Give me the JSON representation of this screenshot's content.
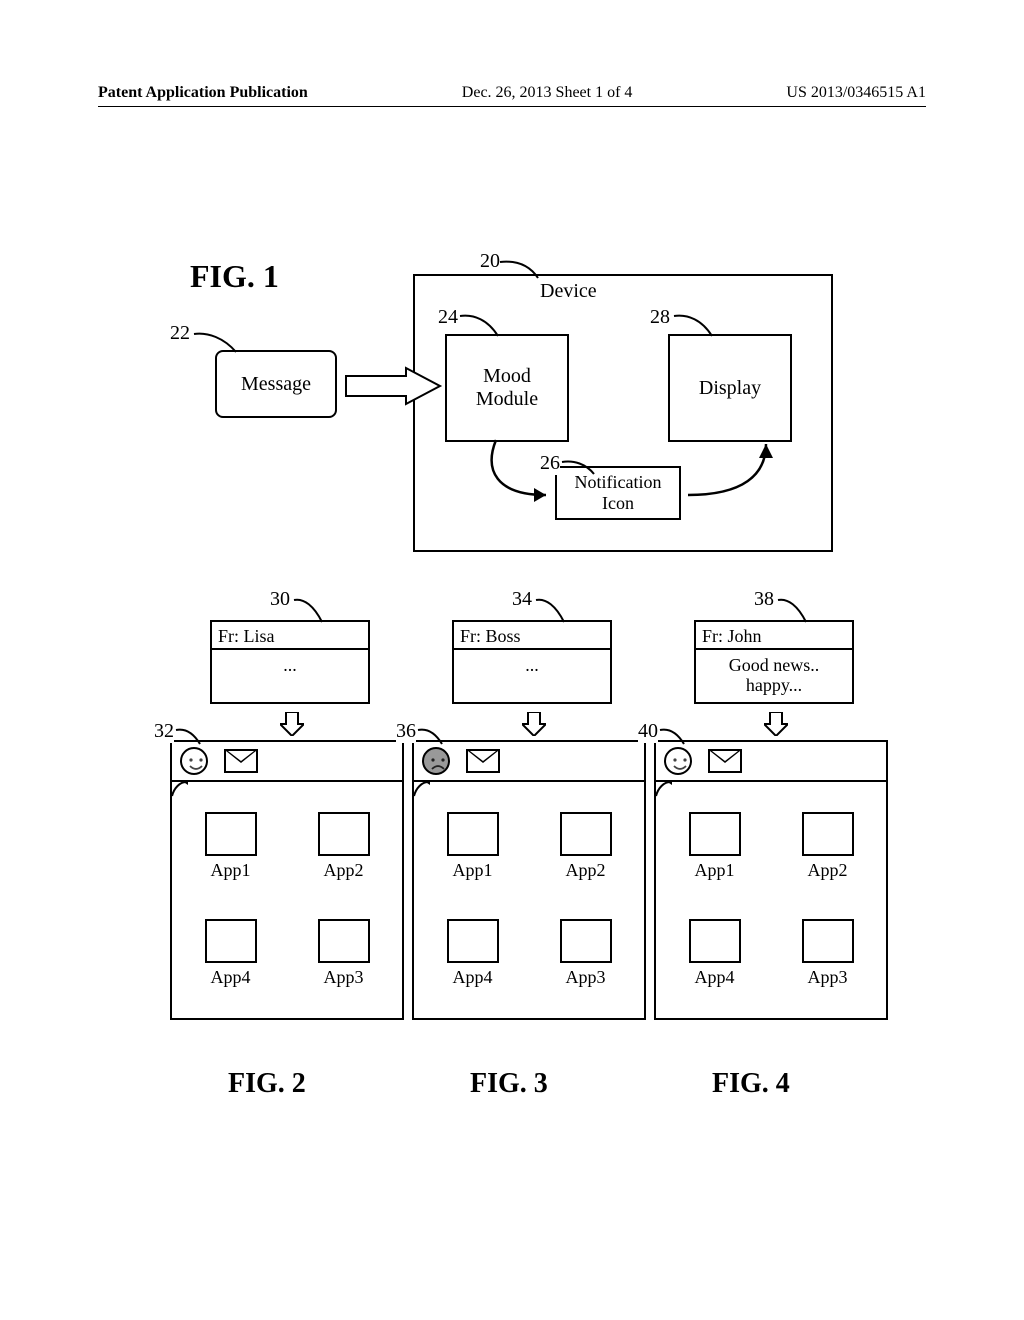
{
  "header": {
    "left": "Patent Application Publication",
    "center": "Dec. 26, 2013  Sheet 1 of 4",
    "right": "US 2013/0346515 A1"
  },
  "fig1": {
    "title": "FIG. 1",
    "refs": {
      "r20": "20",
      "r22": "22",
      "r24": "24",
      "r26": "26",
      "r28": "28"
    },
    "device_label": "Device",
    "message": "Message",
    "mood": "Mood\nModule",
    "display": "Display",
    "notification": "Notification\nIcon"
  },
  "figs234": {
    "refs": {
      "r30": "30",
      "r32": "32",
      "r34": "34",
      "r36": "36",
      "r38": "38",
      "r40": "40"
    },
    "cols": [
      {
        "from": "Fr: Lisa",
        "body": "...",
        "mood": "happy",
        "apps": [
          "App1",
          "App2",
          "App4",
          "App3"
        ],
        "caption": "FIG. 2"
      },
      {
        "from": "Fr: Boss",
        "body": "...",
        "mood": "sad",
        "apps": [
          "App1",
          "App2",
          "App4",
          "App3"
        ],
        "caption": "FIG. 3"
      },
      {
        "from": "Fr: John",
        "body": "Good news.. happy...",
        "mood": "happy",
        "apps": [
          "App1",
          "App2",
          "App4",
          "App3"
        ],
        "caption": "FIG. 4"
      }
    ]
  }
}
